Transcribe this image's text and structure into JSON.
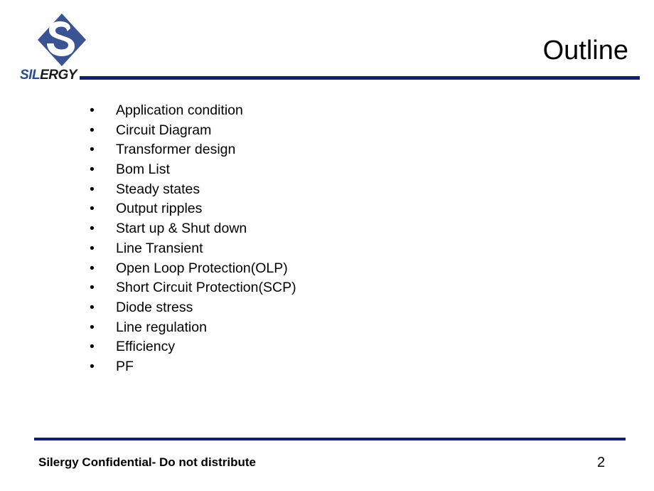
{
  "slide": {
    "title": "Outline",
    "page_number": "2",
    "bullet_marker": "•"
  },
  "brand": {
    "logo_icon": "silergy-diamond-s-logo",
    "wordmark_primary": "SIL",
    "wordmark_secondary": "ERGY",
    "logo_blue": "#2c4a8c",
    "rule_navy": "#131f6b"
  },
  "outline": {
    "items": [
      {
        "label": "Application condition"
      },
      {
        "label": "Circuit Diagram"
      },
      {
        "label": "Transformer design"
      },
      {
        "label": "Bom List"
      },
      {
        "label": "Steady states"
      },
      {
        "label": "Output ripples"
      },
      {
        "label": "Start up & Shut down"
      },
      {
        "label": "Line Transient"
      },
      {
        "label": "Open Loop Protection(OLP)"
      },
      {
        "label": "Short Circuit Protection(SCP)"
      },
      {
        "label": "Diode stress"
      },
      {
        "label": "Line regulation"
      },
      {
        "label": "Efficiency"
      },
      {
        "label": "PF"
      }
    ]
  },
  "footer": {
    "confidential_note": "Silergy Confidential- Do not distribute"
  }
}
